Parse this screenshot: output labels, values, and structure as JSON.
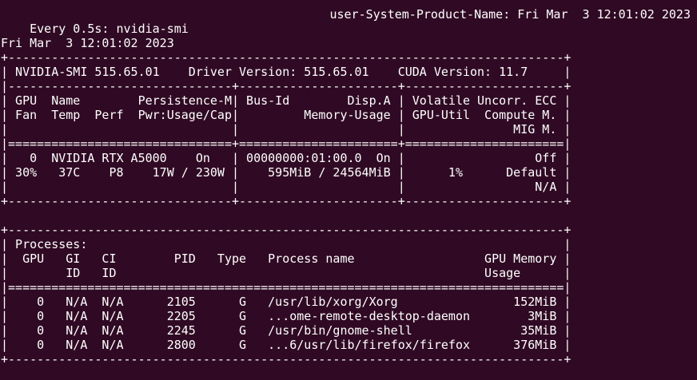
{
  "watch": {
    "command": "Every 0.5s: nvidia-smi",
    "host_time": "user-System-Product-Name: Fri Mar  3 12:01:02 2023"
  },
  "output": {
    "timestamp": "Fri Mar  3 12:01:02 2023",
    "gpu_table": [
      "+-----------------------------------------------------------------------------+",
      "| NVIDIA-SMI 515.65.01    Driver Version: 515.65.01    CUDA Version: 11.7     |",
      "|-------------------------------+----------------------+----------------------+",
      "| GPU  Name        Persistence-M| Bus-Id        Disp.A | Volatile Uncorr. ECC |",
      "| Fan  Temp  Perf  Pwr:Usage/Cap|         Memory-Usage | GPU-Util  Compute M. |",
      "|                               |                      |               MIG M. |",
      "|===============================+======================+======================|",
      "|   0  NVIDIA RTX A5000    On   | 00000000:01:00.0  On |                  Off |",
      "| 30%   37C    P8    17W / 230W |    595MiB / 24564MiB |      1%      Default |",
      "|                               |                      |                  N/A |",
      "+-------------------------------+----------------------+----------------------+"
    ],
    "process_table": [
      "+-----------------------------------------------------------------------------+",
      "| Processes:                                                                  |",
      "|  GPU   GI   CI        PID   Type   Process name                  GPU Memory |",
      "|        ID   ID                                                   Usage      |",
      "|=============================================================================|",
      "|    0   N/A  N/A      2105      G   /usr/lib/xorg/Xorg                152MiB |",
      "|    0   N/A  N/A      2205      G   ...ome-remote-desktop-daemon        3MiB |",
      "|    0   N/A  N/A      2245      G   /usr/bin/gnome-shell               35MiB |",
      "|    0   N/A  N/A      2800      G   ...6/usr/lib/firefox/firefox      376MiB |",
      "+-----------------------------------------------------------------------------+"
    ]
  },
  "colors": {
    "background": "#300a24",
    "text": "#ffffff"
  }
}
